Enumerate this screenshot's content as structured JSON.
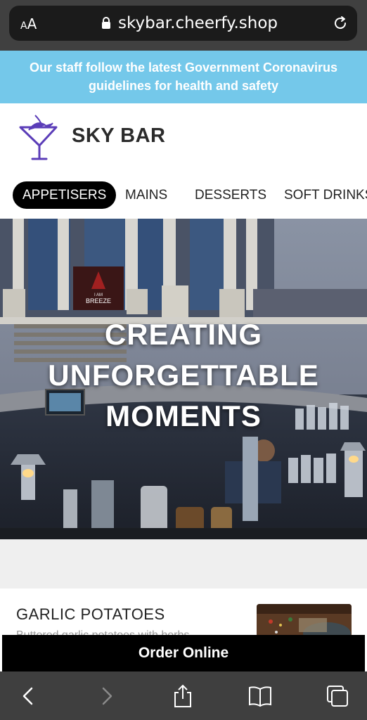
{
  "browser": {
    "text_size_label_small": "A",
    "text_size_label_large": "A",
    "url": "skybar.cheerfy.shop"
  },
  "notice": {
    "text": "Our staff follow the latest Government Coronavirus guidelines for health and safety"
  },
  "header": {
    "brand_name": "SKY BAR"
  },
  "tabs": [
    {
      "label": "APPETISERS",
      "active": true
    },
    {
      "label": "MAINS",
      "active": false
    },
    {
      "label": "DESSERTS",
      "active": false
    },
    {
      "label": "SOFT DRINKS",
      "active": false
    }
  ],
  "hero": {
    "line1": "CREATING",
    "line2": "UNFORGETTABLE",
    "line3": "MOMENTS",
    "sign_top": "I AM",
    "sign_bottom": "BREEZE"
  },
  "menu_items": [
    {
      "name": "GARLIC POTATOES",
      "description": "Buttered garlic potatoes with herbs"
    }
  ],
  "order_button": {
    "label": "Order Online"
  },
  "colors": {
    "notice_bg": "#74c8ea",
    "logo_purple": "#5b3db8",
    "primary": "#000000"
  },
  "icons": [
    "lock-icon",
    "reload-icon",
    "martini-logo-icon",
    "back-icon",
    "forward-icon",
    "share-icon",
    "bookmarks-icon",
    "tabs-icon"
  ]
}
